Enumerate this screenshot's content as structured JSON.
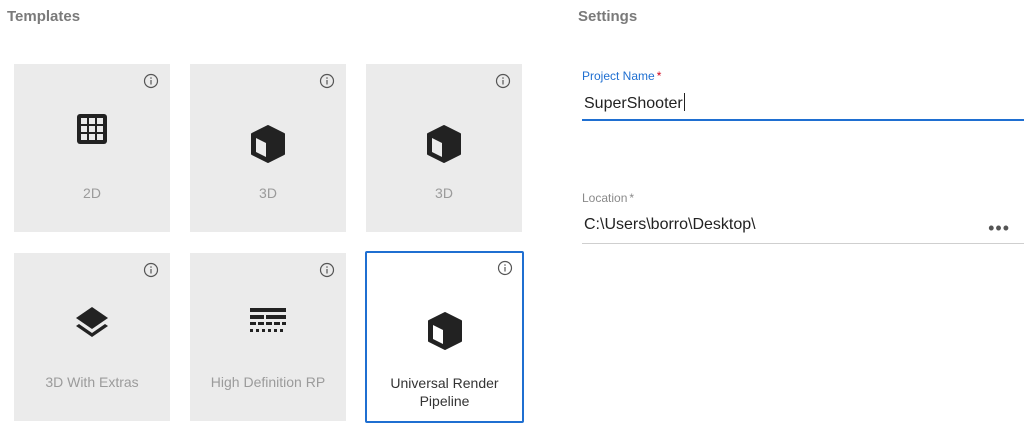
{
  "templates": {
    "title": "Templates",
    "items": [
      {
        "label": "2D",
        "icon": "grid-icon",
        "selected": false
      },
      {
        "label": "3D",
        "icon": "cube-icon",
        "selected": false
      },
      {
        "label": "3D",
        "icon": "cube-icon",
        "selected": false
      },
      {
        "label": "3D With Extras",
        "icon": "layers-icon",
        "selected": false
      },
      {
        "label": "High Definition RP",
        "icon": "hdrp-icon",
        "selected": false
      },
      {
        "label": "Universal Render Pipeline",
        "icon": "cube-icon",
        "selected": true
      }
    ]
  },
  "settings": {
    "title": "Settings",
    "project_name": {
      "label": "Project Name",
      "required": "*",
      "value": "SuperShooter"
    },
    "location": {
      "label": "Location",
      "required": "*",
      "value": "C:\\Users\\borro\\Desktop\\",
      "browse": "•••"
    }
  },
  "colors": {
    "accent": "#1f6fd1",
    "card_bg": "#ebebeb",
    "label_gray": "#9b9b9b"
  }
}
